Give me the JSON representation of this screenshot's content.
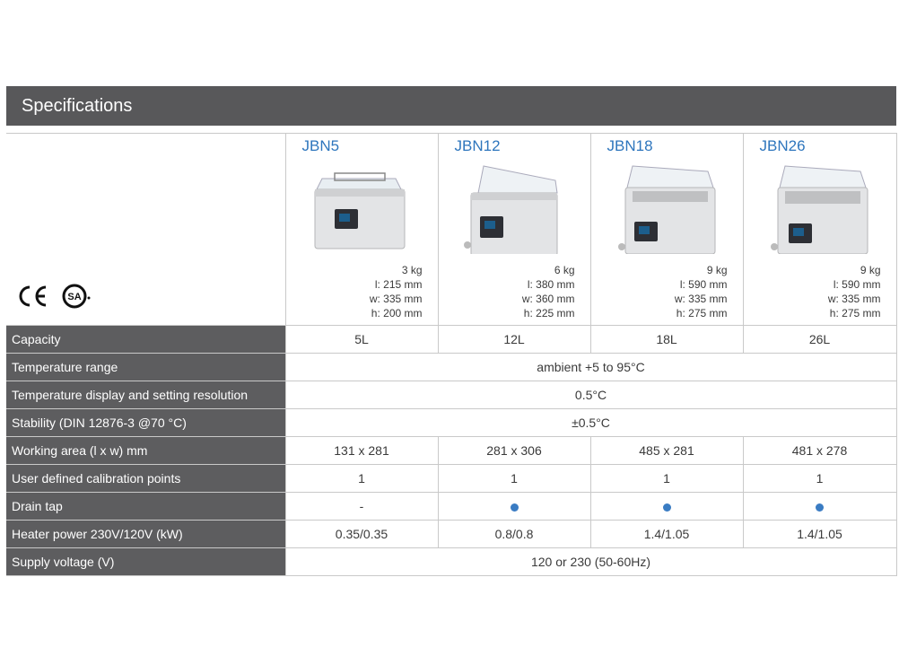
{
  "header": {
    "title": "Specifications"
  },
  "certifications": [
    "CE",
    "CSA"
  ],
  "models": [
    {
      "name": "JBN5",
      "weight": "3 kg",
      "l": "l: 215 mm",
      "w": "w: 335 mm",
      "h": "h: 200 mm"
    },
    {
      "name": "JBN12",
      "weight": "6 kg",
      "l": "l: 380 mm",
      "w": "w: 360 mm",
      "h": "h:  225 mm"
    },
    {
      "name": "JBN18",
      "weight": "9 kg",
      "l": "l: 590 mm",
      "w": "w: 335 mm",
      "h": "h:  275 mm"
    },
    {
      "name": "JBN26",
      "weight": "9 kg",
      "l": "l: 590 mm",
      "w": "w: 335 mm",
      "h": "h:  275 mm"
    }
  ],
  "rows": [
    {
      "label": "Capacity",
      "values": [
        "5L",
        "12L",
        "18L",
        "26L"
      ]
    },
    {
      "label": "Temperature range",
      "span": "ambient +5 to 95°C"
    },
    {
      "label": "Temperature display and setting resolution",
      "span": "0.5°C"
    },
    {
      "label": "Stability (DIN 12876-3 @70 °C)",
      "span": "±0.5°C"
    },
    {
      "label": "Working area (l x w) mm",
      "values": [
        "131 x 281",
        "281 x 306",
        "485 x 281",
        "481 x 278"
      ]
    },
    {
      "label": "User defined calibration points",
      "values": [
        "1",
        "1",
        "1",
        "1"
      ]
    },
    {
      "label": "Drain tap",
      "values": [
        "-",
        "●",
        "●",
        "●"
      ]
    },
    {
      "label": "Heater power 230V/120V (kW)",
      "values": [
        "0.35/0.35",
        "0.8/0.8",
        "1.4/1.05",
        "1.4/1.05"
      ]
    },
    {
      "label": "Supply voltage (V)",
      "span": "120 or 230 (50-60Hz)"
    }
  ],
  "colors": {
    "banner": "#58585a",
    "label_bg": "#5d5d5f",
    "model_name": "#2e76bd",
    "dot": "#3a7cc3"
  }
}
